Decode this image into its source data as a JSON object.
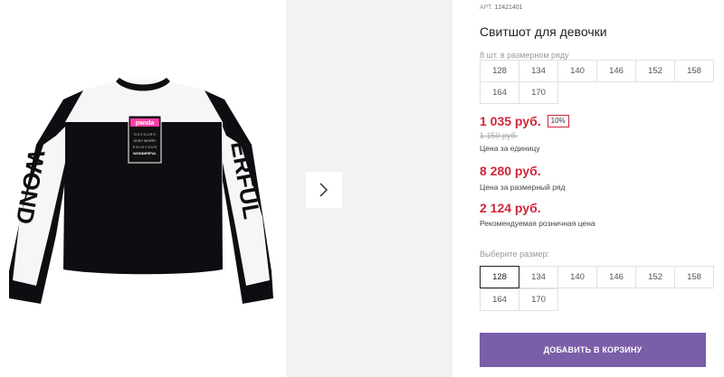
{
  "article": {
    "label": "АРТ.",
    "number": "12421401"
  },
  "product": {
    "title": "Свитшот для девочки"
  },
  "pack": {
    "quantity_text": "8 шт. в размерном ряду",
    "sizes": [
      "128",
      "134",
      "140",
      "146",
      "152",
      "158",
      "164",
      "170"
    ]
  },
  "prices": {
    "unit_price": "1 035 руб.",
    "discount": "10%",
    "old_price": "1 150 руб.",
    "unit_caption": "Цена за единицу",
    "pack_price": "8 280 руб.",
    "pack_caption": "Цена за размерный ряд",
    "retail_price": "2 124 руб.",
    "retail_caption": "Рекомендуемая розничная цена"
  },
  "size_select": {
    "label": "Выберите размер:",
    "selected": "128",
    "options": [
      "128",
      "134",
      "140",
      "146",
      "152",
      "158",
      "164",
      "170"
    ]
  },
  "cart": {
    "add_label": "ДОБАВИТЬ В КОРЗИНУ"
  },
  "garment_print": {
    "patch_brand": "panda",
    "patch_word": "WONDERFUL",
    "left_sleeve": "WOND",
    "right_sleeve": "ERFUL"
  },
  "colors": {
    "accent": "#7b5ea8",
    "price": "#d0263b"
  }
}
